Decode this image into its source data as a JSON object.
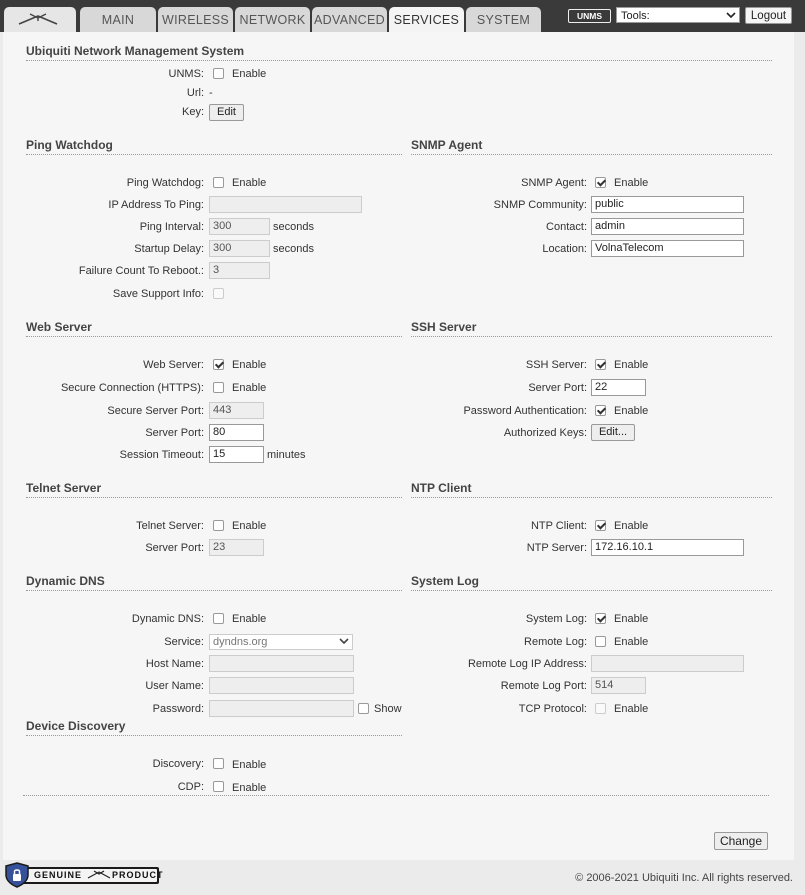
{
  "nav": {
    "tabs": [
      {
        "label": "MAIN",
        "active": false
      },
      {
        "label": "WIRELESS",
        "active": false
      },
      {
        "label": "NETWORK",
        "active": false
      },
      {
        "label": "ADVANCED",
        "active": false
      },
      {
        "label": "SERVICES",
        "active": true
      },
      {
        "label": "SYSTEM",
        "active": false
      }
    ],
    "unms_badge": "UNMS",
    "tools_value": "Tools:",
    "logout_label": "Logout"
  },
  "common": {
    "enable": "Enable",
    "seconds": "seconds",
    "minutes": "minutes",
    "show": "Show",
    "edit": "Edit",
    "edit_dots": "Edit...",
    "change": "Change"
  },
  "unms": {
    "title": "Ubiquiti Network Management System",
    "unms_label": "UNMS:",
    "unms_enabled": false,
    "url_label": "Url:",
    "url_value": "-",
    "key_label": "Key:"
  },
  "ping": {
    "title": "Ping Watchdog",
    "watchdog_label": "Ping Watchdog:",
    "watchdog_enabled": false,
    "ip_label": "IP Address To Ping:",
    "ip_value": "",
    "interval_label": "Ping Interval:",
    "interval_value": "300",
    "startup_label": "Startup Delay:",
    "startup_value": "300",
    "failure_label": "Failure Count To Reboot.:",
    "failure_value": "3",
    "support_label": "Save Support Info:",
    "support_enabled": false
  },
  "snmp": {
    "title": "SNMP Agent",
    "agent_label": "SNMP Agent:",
    "agent_enabled": true,
    "community_label": "SNMP Community:",
    "community_value": "public",
    "contact_label": "Contact:",
    "contact_value": "admin",
    "location_label": "Location:",
    "location_value": "VolnaTelecom"
  },
  "web": {
    "title": "Web Server",
    "server_label": "Web Server:",
    "server_enabled": true,
    "https_label": "Secure Connection (HTTPS):",
    "https_enabled": false,
    "secure_port_label": "Secure Server Port:",
    "secure_port_value": "443",
    "port_label": "Server Port:",
    "port_value": "80",
    "timeout_label": "Session Timeout:",
    "timeout_value": "15"
  },
  "ssh": {
    "title": "SSH Server",
    "server_label": "SSH Server:",
    "server_enabled": true,
    "port_label": "Server Port:",
    "port_value": "22",
    "password_label": "Password Authentication:",
    "password_enabled": true,
    "keys_label": "Authorized Keys:"
  },
  "telnet": {
    "title": "Telnet Server",
    "server_label": "Telnet Server:",
    "server_enabled": false,
    "port_label": "Server Port:",
    "port_value": "23"
  },
  "ntp": {
    "title": "NTP Client",
    "client_label": "NTP Client:",
    "client_enabled": true,
    "server_label": "NTP Server:",
    "server_value": "172.16.10.1"
  },
  "ddns": {
    "title": "Dynamic DNS",
    "ddns_label": "Dynamic DNS:",
    "ddns_enabled": false,
    "service_label": "Service:",
    "service_value": "dyndns.org",
    "host_label": "Host Name:",
    "host_value": "",
    "user_label": "User Name:",
    "user_value": "",
    "password_label": "Password:",
    "password_value": "",
    "show_enabled": false
  },
  "syslog": {
    "title": "System Log",
    "syslog_label": "System Log:",
    "syslog_enabled": true,
    "remote_label": "Remote Log:",
    "remote_enabled": false,
    "remote_ip_label": "Remote Log IP Address:",
    "remote_ip_value": "",
    "remote_port_label": "Remote Log Port:",
    "remote_port_value": "514",
    "tcp_label": "TCP Protocol:",
    "tcp_enabled": false
  },
  "discovery": {
    "title": "Device Discovery",
    "discovery_label": "Discovery:",
    "discovery_enabled": false,
    "cdp_label": "CDP:",
    "cdp_enabled": false
  },
  "footer": {
    "genuine": "GENUINE",
    "product": "PRODUCT",
    "copyright": "© 2006-2021 Ubiquiti Inc. All rights reserved."
  },
  "colors": {
    "topbar": "#3a3a3a",
    "content_bg": "#f6f6f6",
    "page_bg": "#ebebeb"
  }
}
